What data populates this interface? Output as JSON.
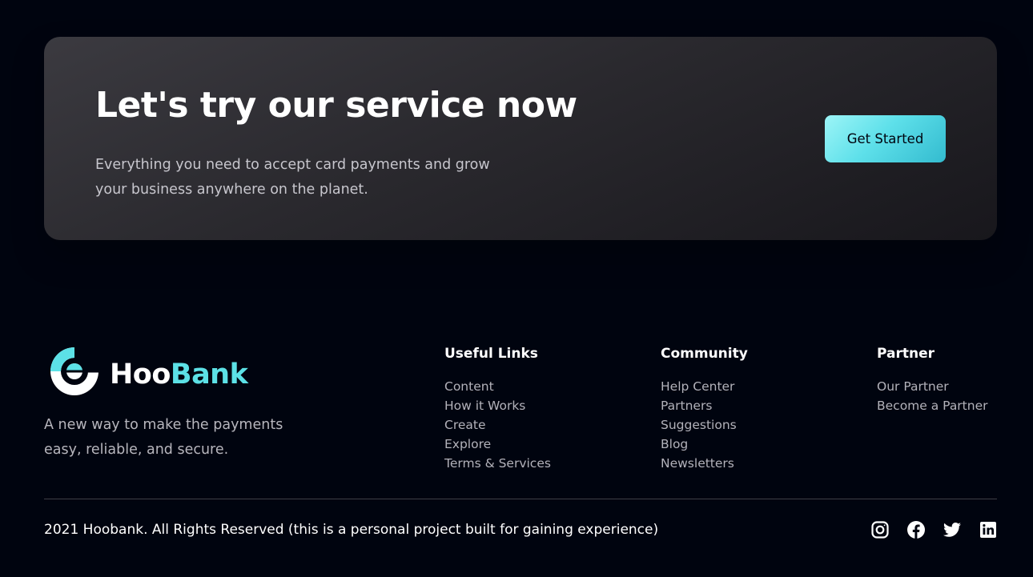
{
  "cta": {
    "title": "Let's try our service now",
    "text": "Everything you need to accept card payments and grow your business anywhere on the planet.",
    "button_label": "Get Started"
  },
  "brand": {
    "name_part1": "Hoo",
    "name_part2": "Bank",
    "tagline": "A new way to make the payments easy, reliable, and secure.",
    "accent_color": "#5ce1e6",
    "logo_icon": "hoobank-logo-icon"
  },
  "footer": {
    "columns": [
      {
        "title": "Useful Links",
        "links": [
          "Content",
          "How it Works",
          "Create",
          "Explore",
          "Terms & Services"
        ]
      },
      {
        "title": "Community",
        "links": [
          "Help Center",
          "Partners",
          "Suggestions",
          "Blog",
          "Newsletters"
        ]
      },
      {
        "title": "Partner",
        "links": [
          "Our Partner",
          "Become a Partner"
        ]
      }
    ],
    "copyright": "2021 Hoobank. All Rights Reserved (this is a personal project built for gaining experience)",
    "socials": [
      {
        "name": "instagram-icon"
      },
      {
        "name": "facebook-icon"
      },
      {
        "name": "twitter-icon"
      },
      {
        "name": "linkedin-icon"
      }
    ]
  },
  "colors": {
    "background": "#00040f",
    "card": "#2b2a30",
    "button_gradient_start": "#9df5f7",
    "button_gradient_end": "#33bbcf"
  }
}
